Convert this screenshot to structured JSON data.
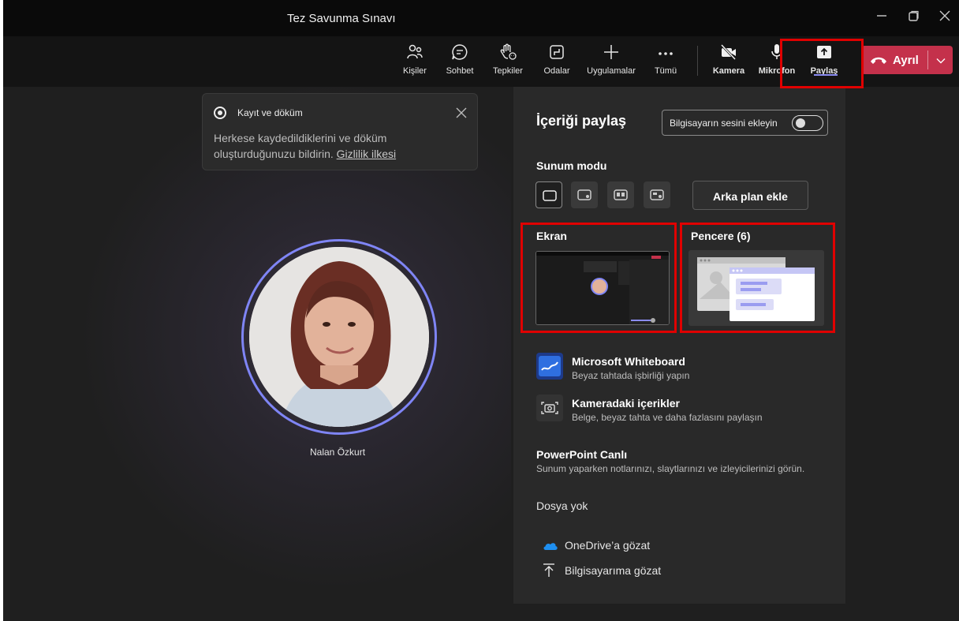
{
  "window": {
    "title": "Tez Savunma Sınavı"
  },
  "toolbar": {
    "items": [
      {
        "label": "Kişiler",
        "icon": "people-icon"
      },
      {
        "label": "Sohbet",
        "icon": "chat-icon"
      },
      {
        "label": "Tepkiler",
        "icon": "raise-hand-icon"
      },
      {
        "label": "Odalar",
        "icon": "rooms-icon"
      },
      {
        "label": "Uygulamalar",
        "icon": "plus-icon"
      },
      {
        "label": "Tümü",
        "icon": "more-icon"
      },
      {
        "label": "Kamera",
        "icon": "camera-off-icon"
      },
      {
        "label": "Mikrofon",
        "icon": "microphone-icon"
      },
      {
        "label": "Paylaş",
        "icon": "share-icon"
      }
    ],
    "leave_label": "Ayrıl"
  },
  "toast": {
    "title": "Kayıt ve döküm",
    "body": "Herkese kaydedildiklerini ve döküm oluşturduğunuzu bildirin.",
    "link": "Gizlilik ilkesi"
  },
  "participant": {
    "name": "Nalan Özkurt"
  },
  "share_panel": {
    "title": "İçeriği paylaş",
    "system_audio_label": "Bilgisayarın sesini ekleyin",
    "system_audio_on": false,
    "presenter_mode_title": "Sunum modu",
    "background_button": "Arka plan ekle",
    "screen_label": "Ekran",
    "window_label": "Pencere (6)",
    "options": [
      {
        "title": "Microsoft Whiteboard",
        "subtitle": "Beyaz tahtada işbirliği yapın"
      },
      {
        "title": "Kameradaki içerikler",
        "subtitle": "Belge, beyaz tahta ve daha fazlasını paylaşın"
      }
    ],
    "powerpoint_title": "PowerPoint Canlı",
    "powerpoint_subtitle": "Sunum yaparken notlarınızı, slaytlarınızı ve izleyicilerinizi görün.",
    "no_files": "Dosya yok",
    "browse_onedrive": "OneDrive’a gözat",
    "browse_computer": "Bilgisayarıma gözat"
  },
  "colors": {
    "leave_red": "#c4314b",
    "accent": "#7f85f5",
    "highlight_box": "#e00000"
  }
}
